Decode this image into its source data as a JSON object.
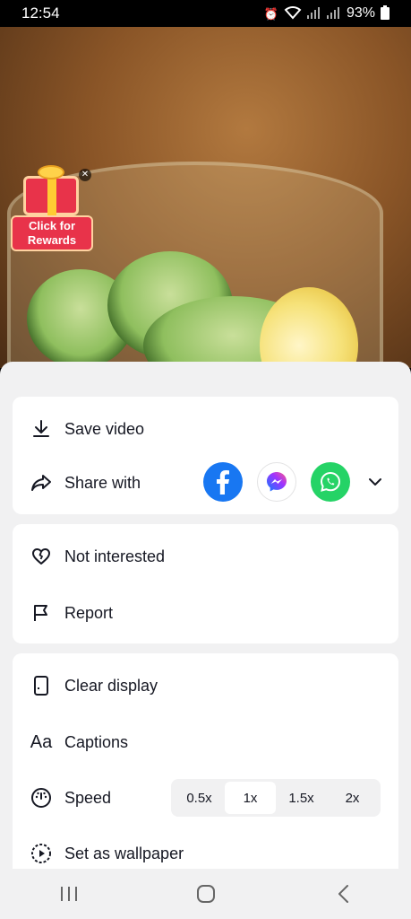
{
  "status_bar": {
    "time": "12:54",
    "battery": "93%"
  },
  "promo": {
    "label_line1": "Click for",
    "label_line2": "Rewards"
  },
  "sheet": {
    "save_video": "Save video",
    "share_with": "Share with",
    "share_targets": [
      "facebook-icon",
      "messenger-icon",
      "whatsapp-icon"
    ],
    "not_interested": "Not interested",
    "report": "Report",
    "clear_display": "Clear display",
    "captions": "Captions",
    "speed": "Speed",
    "speed_options": [
      "0.5x",
      "1x",
      "1.5x",
      "2x"
    ],
    "speed_selected": "1x",
    "set_as_wallpaper": "Set as wallpaper"
  },
  "colors": {
    "facebook": "#1877f2",
    "whatsapp": "#25d366",
    "sheet_bg": "#f1f1f2"
  }
}
